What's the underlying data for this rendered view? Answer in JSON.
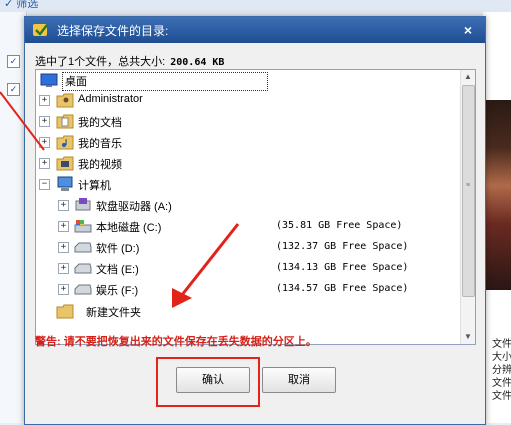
{
  "background": {
    "filter_label": "筛选",
    "side_text": [
      "文件",
      "大小",
      "分辨",
      "文件",
      "文件"
    ]
  },
  "dialog": {
    "title": "选择保存文件的目录:",
    "close_symbol": "×",
    "summary_label": "选中了1个文件，总共大小:",
    "summary_size": "200.64 KB",
    "tree": [
      {
        "label": "桌面",
        "space": "",
        "icon": "desktop-icon",
        "expander": "",
        "selected": true
      },
      {
        "label": "Administrator",
        "space": "",
        "icon": "user-folder-icon",
        "expander": "+"
      },
      {
        "label": "我的文档",
        "space": "",
        "icon": "documents-folder-icon",
        "expander": "+"
      },
      {
        "label": "我的音乐",
        "space": "",
        "icon": "music-folder-icon",
        "expander": "+"
      },
      {
        "label": "我的视频",
        "space": "",
        "icon": "video-folder-icon",
        "expander": "+"
      },
      {
        "label": "计算机",
        "space": "",
        "icon": "computer-icon",
        "expander": "−"
      },
      {
        "label": "软盘驱动器 (A:)",
        "space": "",
        "icon": "floppy-drive-icon",
        "expander": "+"
      },
      {
        "label": "本地磁盘 (C:)",
        "space": "(35.81 GB Free Space)",
        "icon": "system-drive-icon",
        "expander": "+"
      },
      {
        "label": "软件 (D:)",
        "space": "(132.37 GB Free Space)",
        "icon": "drive-icon",
        "expander": "+"
      },
      {
        "label": "文档 (E:)",
        "space": "(134.13 GB Free Space)",
        "icon": "drive-icon",
        "expander": "+"
      },
      {
        "label": "娱乐 (F:)",
        "space": "(134.57 GB Free Space)",
        "icon": "drive-icon",
        "expander": "+"
      },
      {
        "label": "新建文件夹",
        "space": "",
        "icon": "folder-icon",
        "expander": ""
      }
    ],
    "warning": "警告: 请不要把恢复出来的文件保存在丢失数据的分区上。",
    "ok_label": "确认",
    "cancel_label": "取消"
  },
  "colors": {
    "titlebar": "#1e4d92",
    "warning": "#d4221a",
    "annotation": "#e2231a"
  }
}
